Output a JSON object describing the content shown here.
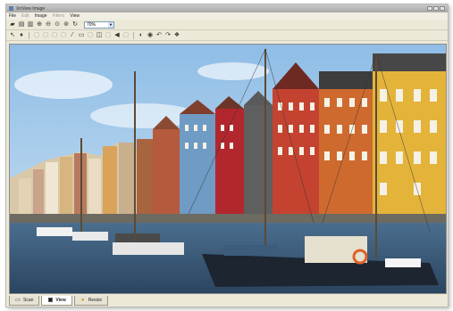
{
  "window": {
    "title": "XnView Image"
  },
  "menu": [
    "File",
    "Edit",
    "Image",
    "Filters",
    "View"
  ],
  "zoom": {
    "value": "70%"
  },
  "tabs": [
    {
      "label": "Scan",
      "icon": "scan-icon",
      "active": false
    },
    {
      "label": "View",
      "icon": "view-icon",
      "active": true
    },
    {
      "label": "Resize",
      "icon": "resize-icon",
      "active": false
    }
  ],
  "image": {
    "subject": "harbor-photo"
  }
}
